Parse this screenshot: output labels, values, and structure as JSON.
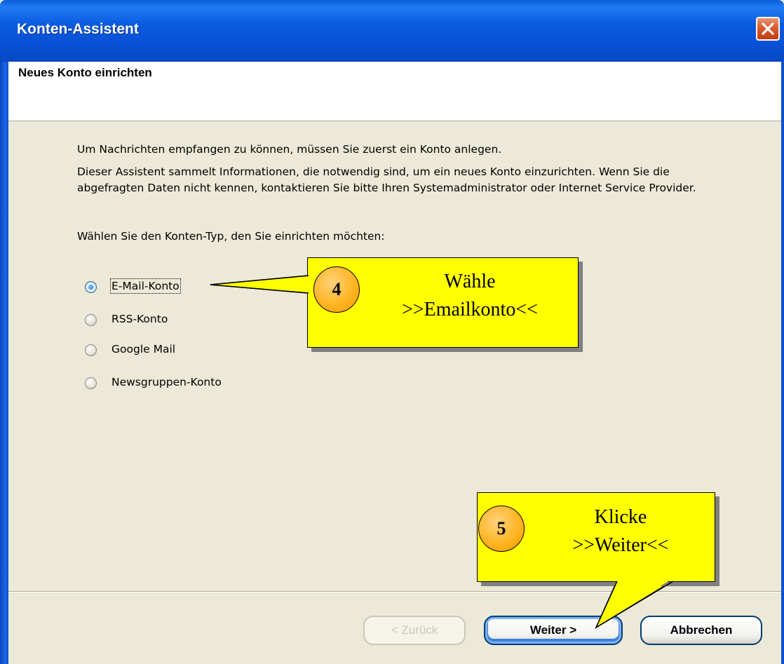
{
  "window": {
    "title": "Konten-Assistent",
    "header": "Neues Konto einrichten"
  },
  "body": {
    "intro": "Um Nachrichten empfangen zu können, müssen Sie zuerst ein Konto anlegen.",
    "info": "Dieser Assistent sammelt Informationen, die notwendig sind, um ein neues Konto einzurichten. Wenn Sie die abgefragten Daten nicht kennen, kontaktieren Sie bitte Ihren Systemadministrator oder Internet Service Provider.",
    "prompt": "Wählen Sie den Konten-Typ, den Sie einrichten möchten:"
  },
  "account_types": [
    {
      "label": "E-Mail-Konto",
      "selected": true
    },
    {
      "label": "RSS-Konto",
      "selected": false
    },
    {
      "label": "Google Mail",
      "selected": false
    },
    {
      "label": "Newsgruppen-Konto",
      "selected": false
    }
  ],
  "buttons": {
    "back": "< Zurück",
    "next": "Weiter >",
    "cancel": "Abbrechen"
  },
  "annotations": [
    {
      "number": "4",
      "line1": "Wähle",
      "line2": ">>Emailkonto<<"
    },
    {
      "number": "5",
      "line1": "Klicke",
      "line2": ">>Weiter<<"
    }
  ],
  "colors": {
    "titlebar": "#0a5adf",
    "callout": "#ffff00",
    "badge": "#ffb21c"
  },
  "icons": [
    "close-icon"
  ]
}
